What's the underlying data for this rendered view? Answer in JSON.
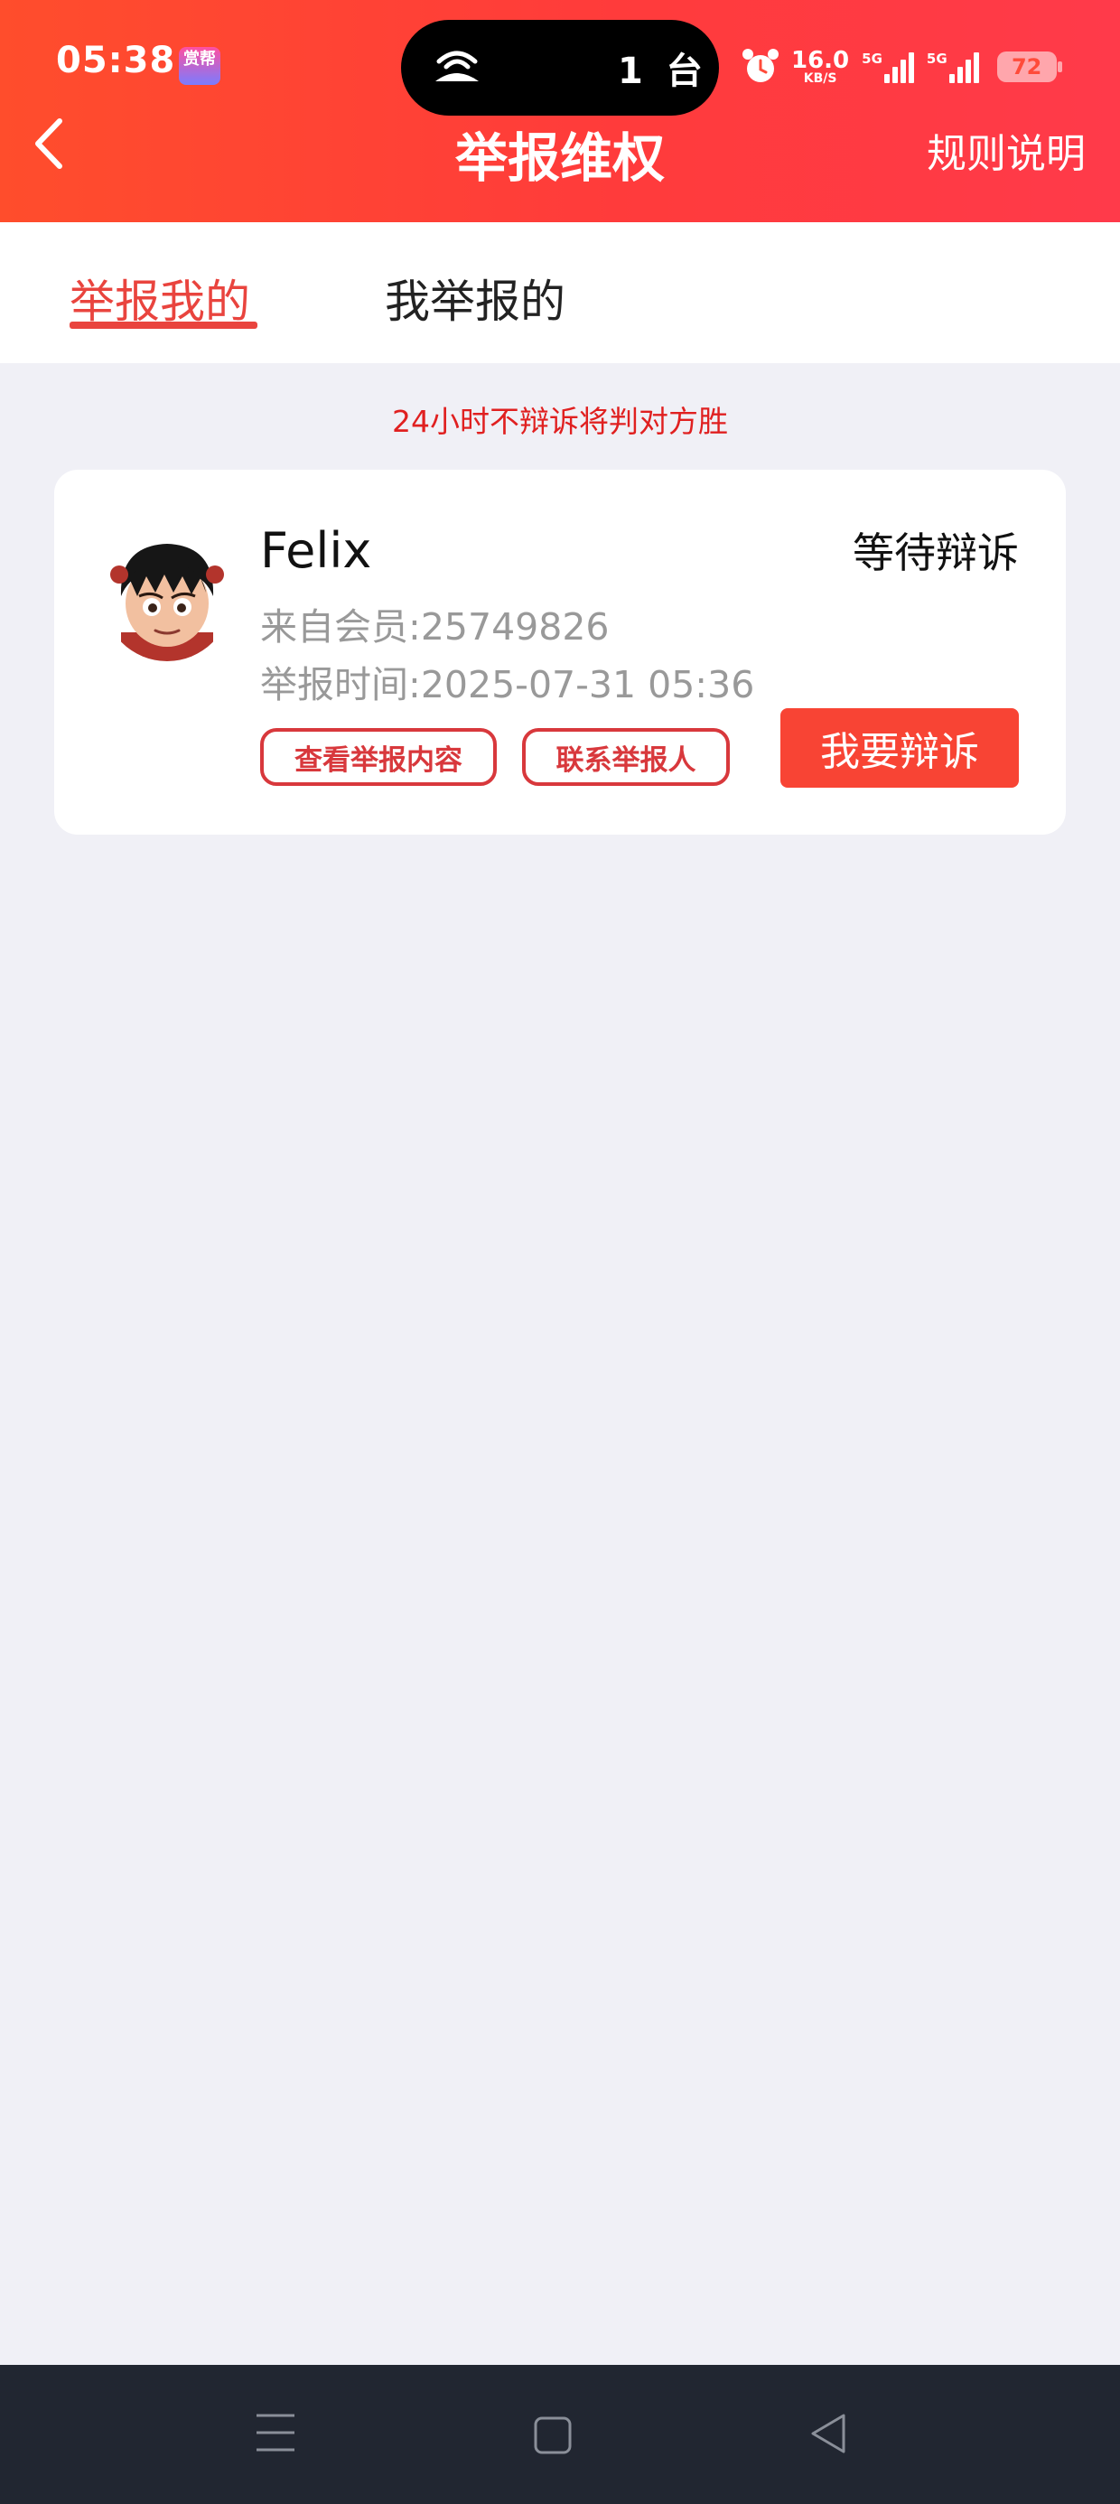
{
  "status_bar": {
    "time": "05:38",
    "app_badge": "赏帮",
    "pill_text": "1 台",
    "net_speed_value": "16.0",
    "net_speed_unit": "KB/S",
    "sim1_label": "5G",
    "sim2_label": "5G",
    "battery": "72"
  },
  "nav": {
    "title": "举报维权",
    "rules_link": "规则说明"
  },
  "tabs": [
    {
      "label": "举报我的",
      "active": true
    },
    {
      "label": "我举报的",
      "active": false
    }
  ],
  "notice": "24小时不辩诉将判对方胜",
  "report": {
    "user_name": "Felix",
    "member": "来自会员:25749826",
    "report_time": "举报时间:2025-07-31 05:36",
    "status": "等待辩诉",
    "view_button": "查看举报内容",
    "contact_button": "联系举报人",
    "appeal_button": "我要辩诉"
  },
  "colors": {
    "header_start": "#ff4d2c",
    "header_end": "#ff3a4a",
    "accent": "#e9443e",
    "notice": "#e02020",
    "appeal_button": "#f84434",
    "background": "#f0f0f6",
    "system_nav": "#212631"
  },
  "icons": {
    "back": "chevron-left-icon",
    "alarm": "alarm-icon",
    "pill": "hotspot-icon",
    "nav_menu": "menu-icon",
    "nav_home": "home-square-icon",
    "nav_back": "back-triangle-icon"
  }
}
